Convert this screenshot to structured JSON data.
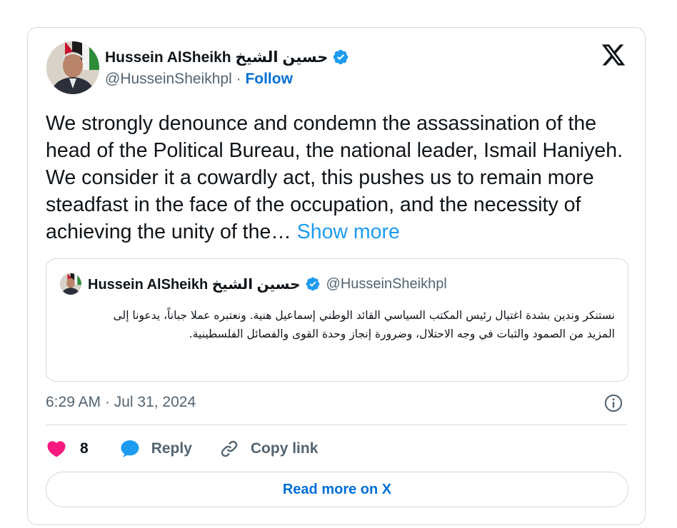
{
  "author": {
    "name": "Hussein AlSheikh حسين الشيخ",
    "handle": "@HusseinSheikhpl",
    "separator": "·",
    "follow_label": "Follow"
  },
  "tweet": {
    "text": "We strongly denounce and condemn the assassination of the head of the Political Bureau, the national leader, Ismail Haniyeh. We consider it a cowardly act, this pushes  us to remain more steadfast in the face of the occupation, and the necessity of achieving the unity of the…",
    "show_more_label": "Show more"
  },
  "quote": {
    "name": "Hussein AlSheikh حسين الشيخ",
    "handle": "@HusseinSheikhpl",
    "text": "نستنكر وندين بشدة اغتيال رئيس المكتب السياسي القائد الوطني إسماعيل هنية. ونعتبره عملا جباناً، يدعونا إلى المزيد من الصمود والثبات في وجه الاحتلال، وضرورة إنجاز وحدة القوى والفصائل الفلسطينية."
  },
  "timestamp": "6:29 AM · Jul 31, 2024",
  "actions": {
    "like_count": "8",
    "reply_label": "Reply",
    "copy_link_label": "Copy link"
  },
  "read_more_label": "Read more on X",
  "colors": {
    "like": "#f91880",
    "reply": "#1d9bf0",
    "verified": "#1d9bf0",
    "link": "#006fd6",
    "muted": "#536471",
    "border": "#cfd9de"
  },
  "icons": {
    "brand": "x-logo-icon",
    "verified": "verified-badge-icon",
    "info": "info-icon",
    "like": "heart-icon",
    "reply": "speech-bubble-icon",
    "copy_link": "link-icon"
  }
}
